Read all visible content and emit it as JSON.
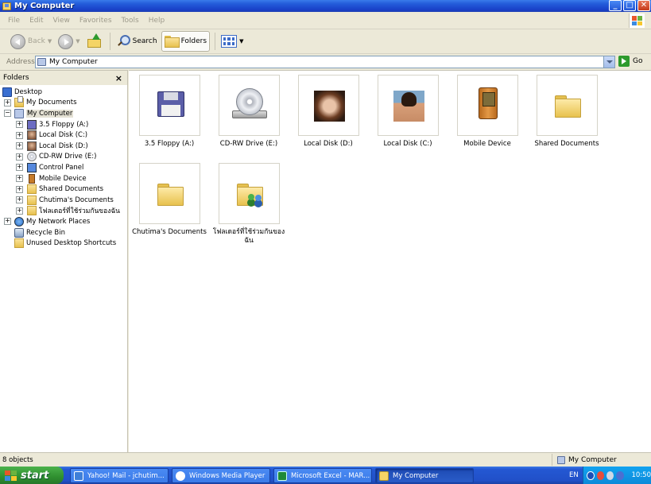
{
  "window": {
    "title": "My Computer",
    "buttons": {
      "minimize": "_",
      "maximize": "□",
      "close": "✕"
    }
  },
  "menu": [
    "File",
    "Edit",
    "View",
    "Favorites",
    "Tools",
    "Help"
  ],
  "toolbar": {
    "back_label": "Back",
    "search_label": "Search",
    "folders_label": "Folders"
  },
  "address": {
    "label": "Address",
    "value": "My Computer",
    "go_label": "Go"
  },
  "folders_pane": {
    "title": "Folders",
    "close": "×",
    "tree": [
      {
        "label": "Desktop",
        "icon": "desktop-icon",
        "expander": ""
      },
      {
        "label": "My Documents",
        "icon": "my-documents-icon",
        "expander": "+"
      },
      {
        "label": "My Computer",
        "icon": "my-computer-icon",
        "expander": "−"
      },
      {
        "label": "3.5 Floppy (A:)",
        "icon": "floppy-icon",
        "expander": "+"
      },
      {
        "label": "Local Disk (C:)",
        "icon": "local-disk-icon",
        "expander": "+"
      },
      {
        "label": "Local Disk (D:)",
        "icon": "local-disk-icon",
        "expander": "+"
      },
      {
        "label": "CD-RW Drive (E:)",
        "icon": "cd-drive-icon",
        "expander": "+"
      },
      {
        "label": "Control Panel",
        "icon": "control-panel-icon",
        "expander": "+"
      },
      {
        "label": "Mobile Device",
        "icon": "mobile-device-icon",
        "expander": "+"
      },
      {
        "label": "Shared Documents",
        "icon": "folder-icon",
        "expander": "+"
      },
      {
        "label": "Chutima's Documents",
        "icon": "folder-icon",
        "expander": "+"
      },
      {
        "label": "โฟลเดอร์ที่ใช้ร่วมกันของฉัน",
        "icon": "shared-folder-icon",
        "expander": "+"
      },
      {
        "label": "My Network Places",
        "icon": "network-icon",
        "expander": "+"
      },
      {
        "label": "Recycle Bin",
        "icon": "recycle-bin-icon",
        "expander": ""
      },
      {
        "label": "Unused Desktop Shortcuts",
        "icon": "folder-icon",
        "expander": ""
      }
    ]
  },
  "items": [
    {
      "label": "3.5 Floppy (A:)",
      "icon": "floppy-drive-icon"
    },
    {
      "label": "CD-RW Drive (E:)",
      "icon": "cd-drive-icon"
    },
    {
      "label": "Local Disk (D:)",
      "icon": "local-disk-photo-icon"
    },
    {
      "label": "Local Disk (C:)",
      "icon": "local-disk-photo-icon"
    },
    {
      "label": "Mobile Device",
      "icon": "mobile-device-icon"
    },
    {
      "label": "Shared Documents",
      "icon": "folder-icon"
    },
    {
      "label": "Chutima's Documents",
      "icon": "folder-icon"
    },
    {
      "label": "โฟลเดอร์ที่ใช้ร่วมกันของ ฉัน",
      "icon": "shared-folder-icon"
    }
  ],
  "status": {
    "objects": "8 objects",
    "location": "My Computer"
  },
  "taskbar": {
    "start_label": "start",
    "tasks": [
      {
        "label": "Yahoo! Mail - jchutim...",
        "icon": "ie-icon"
      },
      {
        "label": "Windows Media Player",
        "icon": "media-player-icon"
      },
      {
        "label": "Microsoft Excel - MAR...",
        "icon": "excel-icon"
      },
      {
        "label": "My Computer",
        "icon": "my-computer-icon"
      }
    ],
    "language": "EN",
    "clock": "10:50"
  }
}
